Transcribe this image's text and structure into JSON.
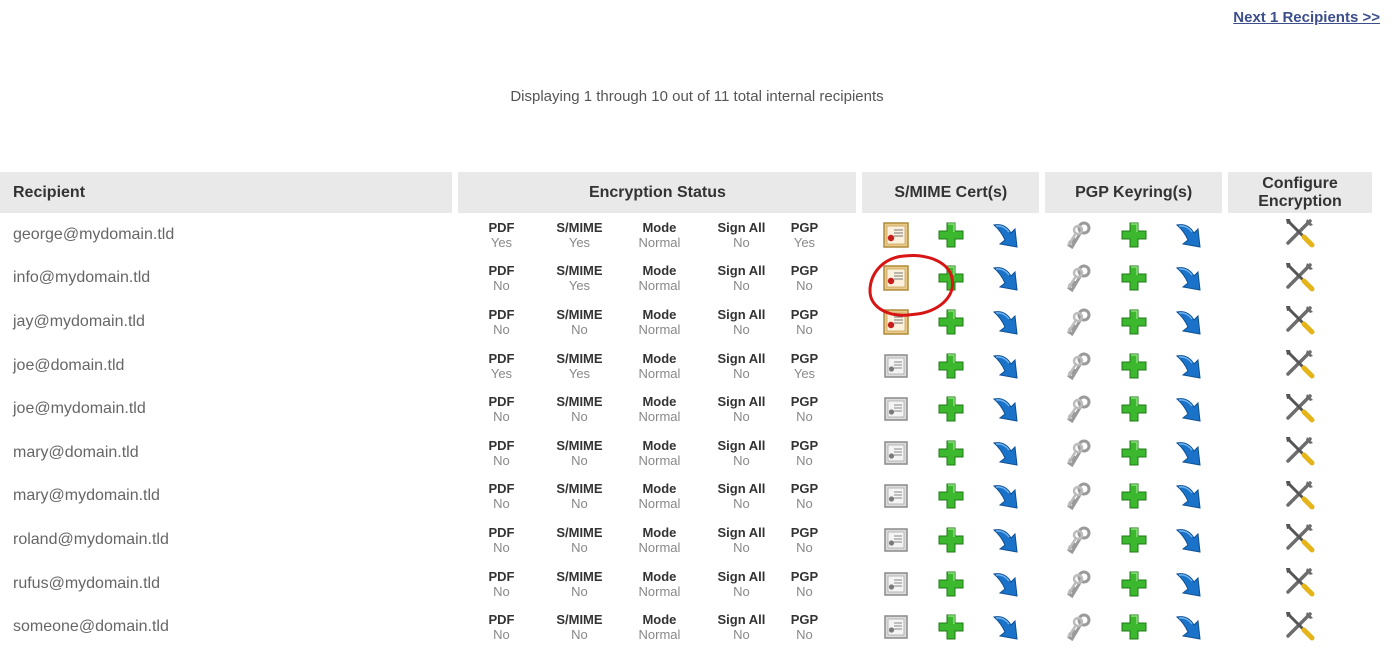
{
  "nav": {
    "next_label": "Next 1 Recipients  >>"
  },
  "summary": "Displaying 1 through 10 out of 11 total internal recipients",
  "columns": {
    "recipient": "Recipient",
    "encryption_status": "Encryption Status",
    "smime_certs": "S/MIME Cert(s)",
    "pgp_keyrings": "PGP Keyring(s)",
    "configure_line1": "Configure",
    "configure_line2": "Encryption"
  },
  "status_labels": {
    "pdf": "PDF",
    "smime": "S/MIME",
    "mode": "Mode",
    "sign_all": "Sign All",
    "pgp": "PGP"
  },
  "rows": [
    {
      "email": "george@mydomain.tld",
      "pdf": "Yes",
      "smime": "Yes",
      "mode": "Normal",
      "sign_all": "No",
      "pgp": "Yes",
      "cert": "active"
    },
    {
      "email": "info@mydomain.tld",
      "pdf": "No",
      "smime": "Yes",
      "mode": "Normal",
      "sign_all": "No",
      "pgp": "No",
      "cert": "active"
    },
    {
      "email": "jay@mydomain.tld",
      "pdf": "No",
      "smime": "No",
      "mode": "Normal",
      "sign_all": "No",
      "pgp": "No",
      "cert": "active"
    },
    {
      "email": "joe@domain.tld",
      "pdf": "Yes",
      "smime": "Yes",
      "mode": "Normal",
      "sign_all": "No",
      "pgp": "Yes",
      "cert": "inactive"
    },
    {
      "email": "joe@mydomain.tld",
      "pdf": "No",
      "smime": "No",
      "mode": "Normal",
      "sign_all": "No",
      "pgp": "No",
      "cert": "inactive"
    },
    {
      "email": "mary@domain.tld",
      "pdf": "No",
      "smime": "No",
      "mode": "Normal",
      "sign_all": "No",
      "pgp": "No",
      "cert": "inactive"
    },
    {
      "email": "mary@mydomain.tld",
      "pdf": "No",
      "smime": "No",
      "mode": "Normal",
      "sign_all": "No",
      "pgp": "No",
      "cert": "inactive"
    },
    {
      "email": "roland@mydomain.tld",
      "pdf": "No",
      "smime": "No",
      "mode": "Normal",
      "sign_all": "No",
      "pgp": "No",
      "cert": "inactive"
    },
    {
      "email": "rufus@mydomain.tld",
      "pdf": "No",
      "smime": "No",
      "mode": "Normal",
      "sign_all": "No",
      "pgp": "No",
      "cert": "inactive"
    },
    {
      "email": "someone@domain.tld",
      "pdf": "No",
      "smime": "No",
      "mode": "Normal",
      "sign_all": "No",
      "pgp": "No",
      "cert": "inactive"
    }
  ],
  "icons": {
    "cert_active": "certificate-icon",
    "cert_inactive": "certificate-gray-icon",
    "add": "plus-icon",
    "import": "blue-arrow-icon",
    "keys": "keys-icon",
    "configure": "tools-icon"
  },
  "colors": {
    "link": "#3d4e8c",
    "header_bg": "#e9e9e9",
    "plus_green": "#3cb82e",
    "arrow_blue": "#1a73c9",
    "annotation_red": "#d81414"
  }
}
